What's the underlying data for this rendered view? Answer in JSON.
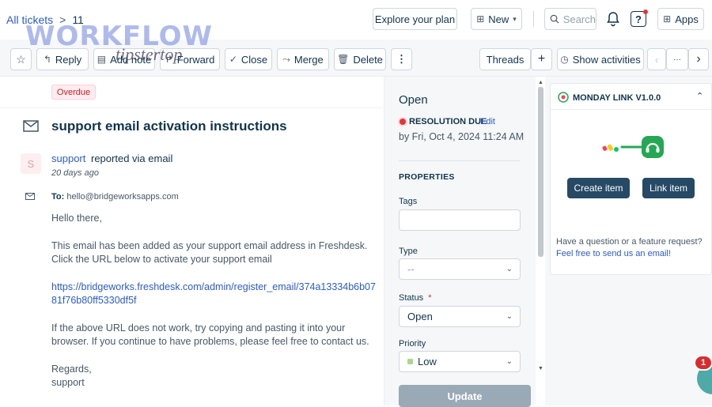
{
  "header": {
    "breadcrumb_root": "All tickets",
    "breadcrumb_sep": ">",
    "ticket_id": "11",
    "explore": "Explore your plan",
    "new_label": "New",
    "search_placeholder": "Search",
    "apps": "Apps"
  },
  "watermark": {
    "line1": "WORKFLOW",
    "line2": "tipstertop"
  },
  "toolbar": {
    "reply": "Reply",
    "add_note": "Add note",
    "forward": "Forward",
    "close": "Close",
    "merge": "Merge",
    "delete": "Delete",
    "more": "⋮",
    "threads": "Threads",
    "plus": "+",
    "show_activities": "Show activities",
    "ellipsis": "···"
  },
  "ticket": {
    "badge": "Overdue",
    "subject": "support email activation instructions",
    "reporter": "support",
    "reported_via": "reported via email",
    "age": "20 days ago",
    "avatar_letter": "S",
    "to_label": "To:",
    "to_address": "hello@bridgeworksapps.com",
    "body": {
      "greeting": "Hello there,",
      "p1_l1": "This email has been added as your support email address in Freshdesk.",
      "p1_l2": "Click the URL below to activate your support email",
      "link_l1": "https://bridgeworks.freshdesk.com/admin/register_email/374a13334b6b07",
      "link_l2": "81f76b80ff5330df5f",
      "p2_l1": "If the above URL does not work, try copying and pasting it into your",
      "p2_l2": "browser. If you continue to have problems, please feel free to contact us.",
      "regards": "Regards,",
      "signature": "support"
    }
  },
  "properties": {
    "status_title": "Open",
    "resolution_label": "RESOLUTION DUE",
    "edit": "Edit",
    "due": "by Fri, Oct 4, 2024 11:24 AM",
    "section": "PROPERTIES",
    "tags_label": "Tags",
    "type_label": "Type",
    "type_value": "--",
    "status_label": "Status",
    "required": "*",
    "status_value": "Open",
    "priority_label": "Priority",
    "priority_value": "Low",
    "update": "Update"
  },
  "monday": {
    "title": "MONDAY LINK V1.0.0",
    "create": "Create item",
    "link": "Link item",
    "q1": "Have a question or a feature request?",
    "q2": "Feel free to send us an email!"
  },
  "notif": {
    "count": "1"
  },
  "colors": {
    "accent": "#2c5cc5",
    "overdue_bg": "#ffecf0",
    "overdue_text": "#c82124",
    "dark_btn": "#264966",
    "monday_green": "#25a754"
  }
}
